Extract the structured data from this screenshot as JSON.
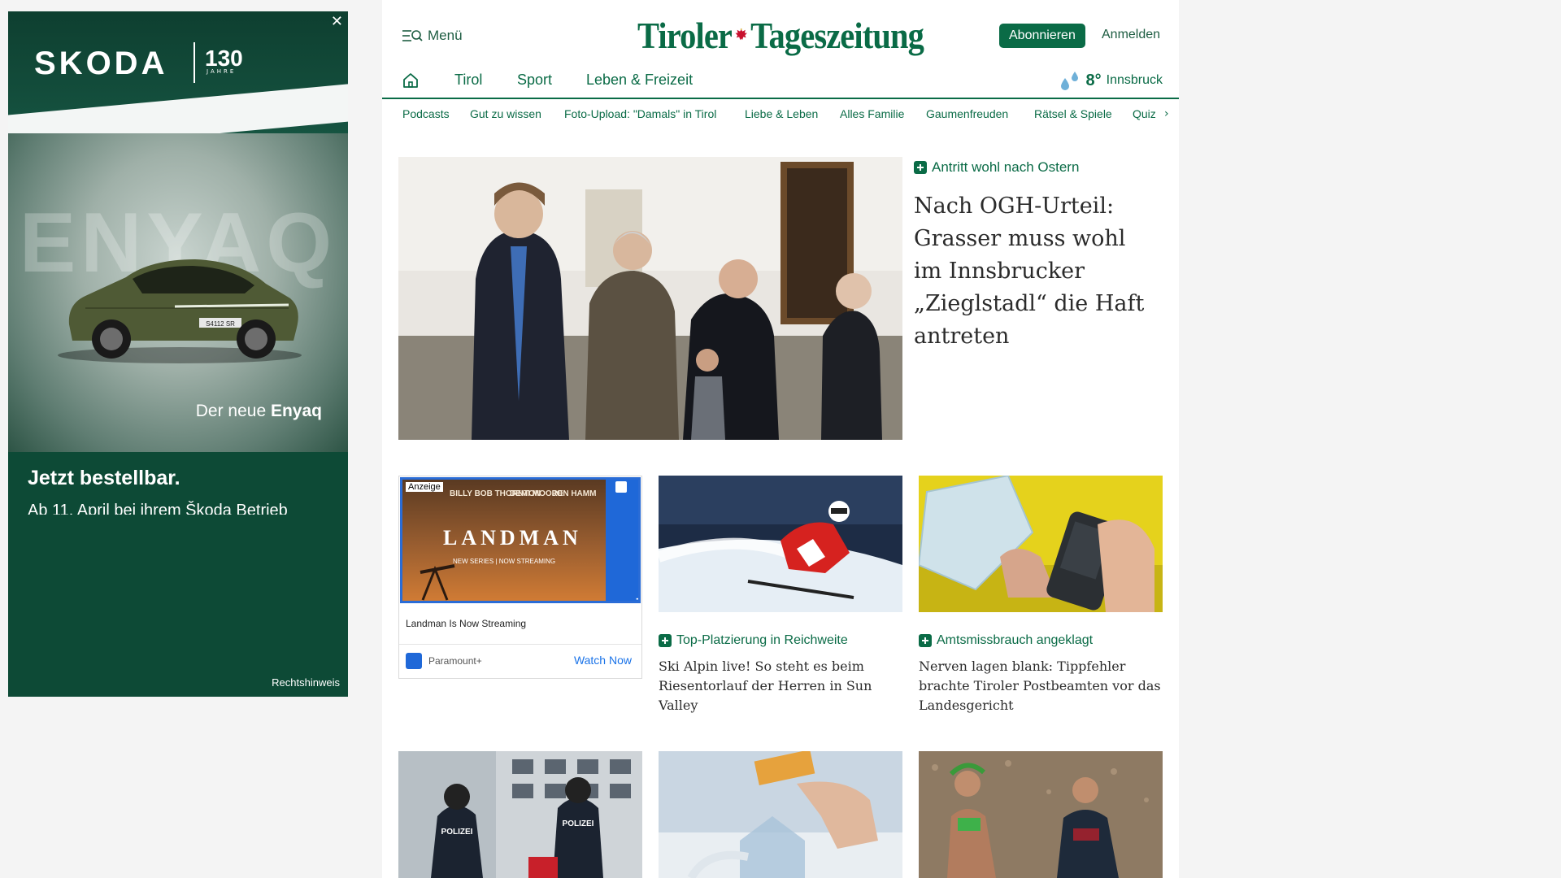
{
  "ad_skoda": {
    "close": "✕",
    "brand": "SKODA",
    "anniversary": "130",
    "anniversary_sub": "JAHRE",
    "watermark": "ENYAQ",
    "plate": "S4112 SR",
    "tagline_prefix": "Der neue ",
    "tagline_model": "Enyaq",
    "cta": "Jetzt bestellbar.",
    "cta_sub": "Ab 11. April bei ihrem Škoda Betrieb",
    "legal": "Rechtshinweis"
  },
  "header": {
    "menu_label": "Menü",
    "logo_part1": "Tiroler",
    "logo_part2": "Tageszeitung",
    "subscribe": "Abonnieren",
    "login": "Anmelden"
  },
  "nav": {
    "items": [
      "Tirol",
      "Sport",
      "Leben & Freizeit"
    ],
    "weather_temp": "8°",
    "weather_city": "Innsbruck"
  },
  "subnav": {
    "items": [
      "Podcasts",
      "Gut zu wissen",
      "Foto-Upload: \"Damals\" in Tirol",
      "Liebe & Leben",
      "Alles Familie",
      "Gaumenfreuden",
      "Rätsel & Spiele",
      "Quiz"
    ]
  },
  "hero": {
    "kicker": "Antritt wohl nach Ostern",
    "title": "Nach OGH-Urteil: Grasser muss wohl im Innsbrucker „Zieglstadl“ die Haft antreten"
  },
  "inline_ad": {
    "label": "Anzeige",
    "cast": [
      "BILLY BOB THORNTON",
      "DEMI MOORE",
      "JON HAMM"
    ],
    "show": "LANDMAN",
    "show_sub": "NEW SERIES | NOW STREAMING",
    "network": "Paramount+",
    "headline": "Landman Is Now Streaming",
    "advertiser": "Paramount+",
    "cta": "Watch Now"
  },
  "cards": [
    {
      "kicker": "Top-Platzierung in Reichweite",
      "title": "Ski Alpin live! So steht es beim Riesentorlauf der Herren in Sun Valley"
    },
    {
      "kicker": "Amtsmissbrauch angeklagt",
      "title": "Nerven lagen blank: Tippfehler brachte Tiroler Postbeamten vor das Landesgericht"
    }
  ],
  "bottom_row": {
    "police_text": "POLIZEI"
  },
  "colors": {
    "brand_green": "#0a6b46",
    "ad_green": "#0d4a36",
    "ad_blue": "#1f68d8"
  }
}
